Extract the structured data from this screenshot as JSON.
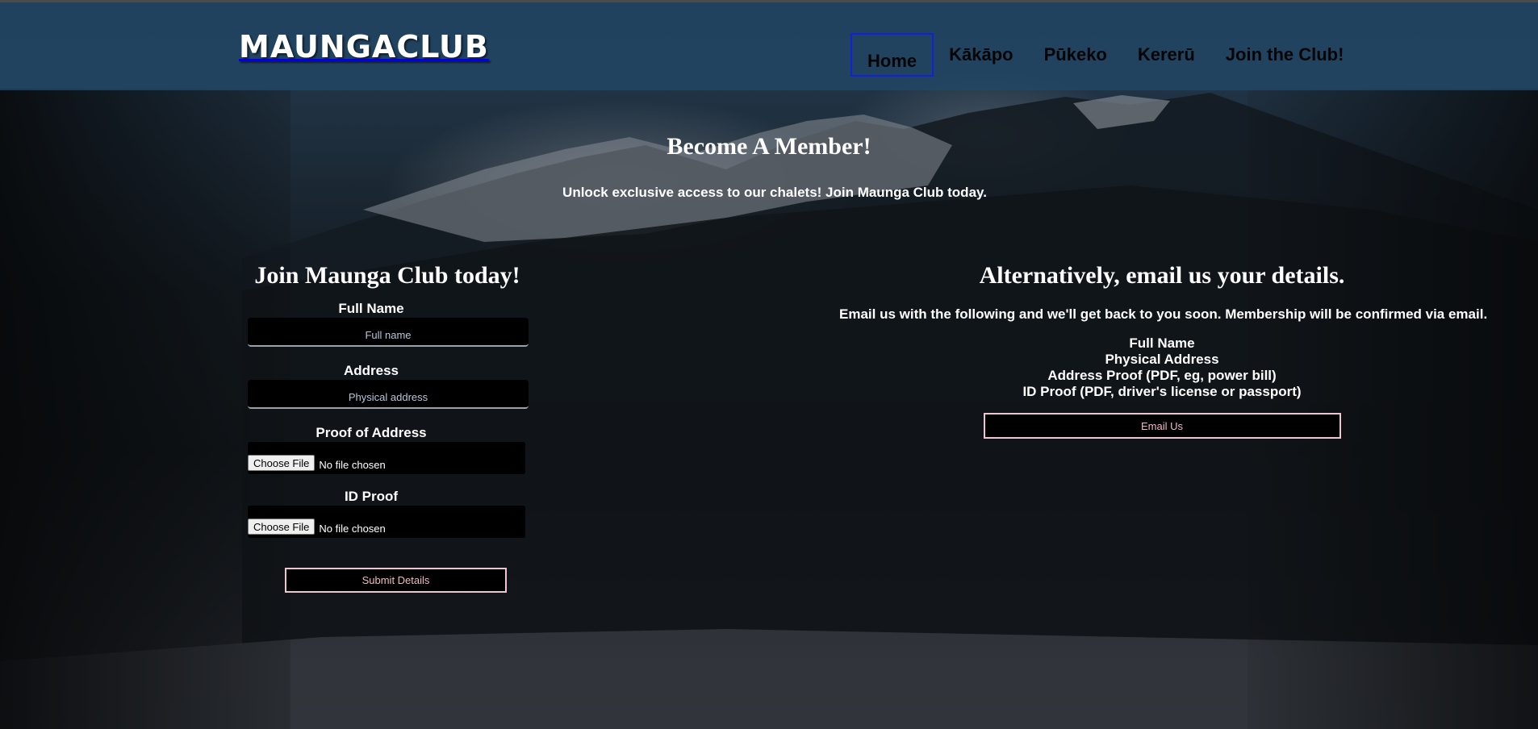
{
  "brand": {
    "logo_text": "MAUNGACLUB"
  },
  "nav": {
    "items": [
      {
        "label": "Home",
        "active": true
      },
      {
        "label": "Kākāpo",
        "active": false
      },
      {
        "label": "Pūkeko",
        "active": false
      },
      {
        "label": "Kererū",
        "active": false
      },
      {
        "label": "Join the Club!",
        "active": false
      }
    ]
  },
  "hero": {
    "title": "Become A Member!",
    "subtitle": "Unlock exclusive access to our chalets! Join Maunga Club today."
  },
  "join_form": {
    "title": "Join Maunga Club today!",
    "full_name_label": "Full Name",
    "full_name_placeholder": "Full name",
    "address_label": "Address",
    "address_placeholder": "Physical address",
    "proof_label": "Proof of Address",
    "id_label": "ID Proof",
    "choose_file_label": "Choose File",
    "no_file_text": "No file chosen",
    "submit_label": "Submit Details"
  },
  "email_section": {
    "title": "Alternatively, email us your details.",
    "description": "Email us with the following and we'll get back to you soon. Membership will be confirmed via email.",
    "requirements": [
      "Full Name",
      "Physical Address",
      "Address Proof (PDF, eg, power bill)",
      "ID Proof (PDF, driver's license or passport)"
    ],
    "button_label": "Email Us"
  },
  "colors": {
    "header_bg": "#224868",
    "active_nav_border": "#1020e0",
    "button_border": "#f0c4d2",
    "button_text": "#f2b8c6"
  }
}
